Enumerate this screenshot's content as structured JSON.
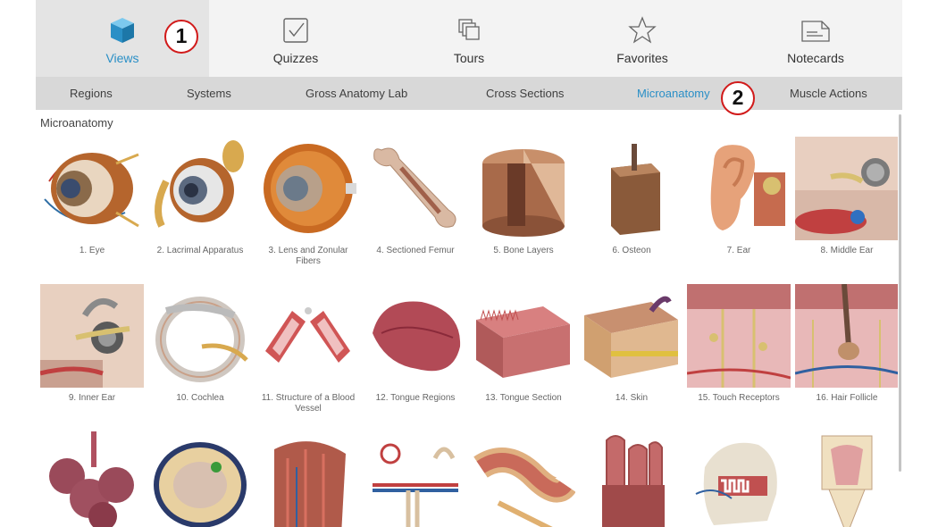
{
  "tabs": [
    {
      "label": "Views",
      "icon": "cube-icon",
      "active": true
    },
    {
      "label": "Quizzes",
      "icon": "checkbox-icon",
      "active": false
    },
    {
      "label": "Tours",
      "icon": "stacked-pages-icon",
      "active": false
    },
    {
      "label": "Favorites",
      "icon": "star-icon",
      "active": false
    },
    {
      "label": "Notecards",
      "icon": "notecard-icon",
      "active": false
    }
  ],
  "subnav": [
    {
      "label": "Regions",
      "active": false
    },
    {
      "label": "Systems",
      "active": false
    },
    {
      "label": "Gross Anatomy Lab",
      "active": false
    },
    {
      "label": "Cross Sections",
      "active": false
    },
    {
      "label": "Microanatomy",
      "active": true
    },
    {
      "label": "Muscle Actions",
      "active": false
    }
  ],
  "markers": [
    "1",
    "2"
  ],
  "section_title": "Microanatomy",
  "items": [
    {
      "label": "1. Eye",
      "art": "eye"
    },
    {
      "label": "2. Lacrimal Apparatus",
      "art": "lacrimal"
    },
    {
      "label": "3. Lens and Zonular Fibers",
      "art": "lens"
    },
    {
      "label": "4. Sectioned Femur",
      "art": "femur"
    },
    {
      "label": "5. Bone Layers",
      "art": "bone"
    },
    {
      "label": "6. Osteon",
      "art": "osteon"
    },
    {
      "label": "7. Ear",
      "art": "ear"
    },
    {
      "label": "8. Middle Ear",
      "art": "middleear"
    },
    {
      "label": "9. Inner Ear",
      "art": "innerear"
    },
    {
      "label": "10. Cochlea",
      "art": "cochlea"
    },
    {
      "label": "11. Structure of a Blood Vessel",
      "art": "vessel"
    },
    {
      "label": "12. Tongue Regions",
      "art": "tongue"
    },
    {
      "label": "13. Tongue Section",
      "art": "tonguesection"
    },
    {
      "label": "14. Skin",
      "art": "skin"
    },
    {
      "label": "15. Touch Receptors",
      "art": "touch"
    },
    {
      "label": "16. Hair Follicle",
      "art": "hair"
    },
    {
      "label": "",
      "art": "alveoli"
    },
    {
      "label": "",
      "art": "cell"
    },
    {
      "label": "",
      "art": "muscle"
    },
    {
      "label": "",
      "art": "nephron"
    },
    {
      "label": "",
      "art": "intestine"
    },
    {
      "label": "",
      "art": "villi"
    },
    {
      "label": "",
      "art": "skull"
    },
    {
      "label": "",
      "art": "tooth"
    }
  ],
  "colors": {
    "accent": "#2a8fc6",
    "marker": "#d11a1a",
    "tab_bg": "#f3f3f3",
    "tab_active_bg": "#e4e4e4",
    "subnav_bg": "#d8d8d8"
  }
}
